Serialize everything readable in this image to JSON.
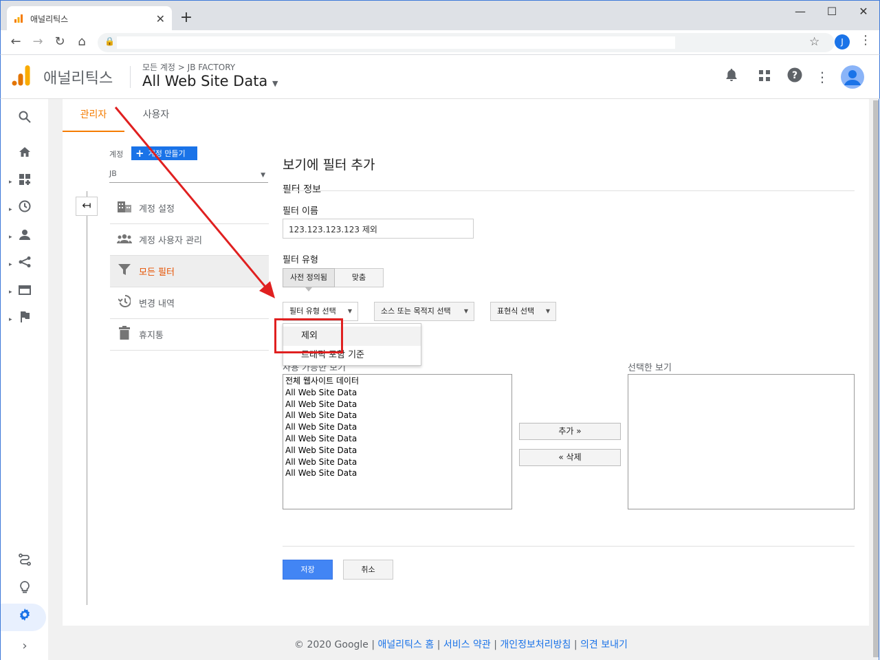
{
  "browser": {
    "tab_title": "애널리틱스",
    "new_tab": "+",
    "profile_initial": "J"
  },
  "header": {
    "app_name": "애널리틱스",
    "breadcrumb": "모든 계정 > JB FACTORY",
    "property_name": "All Web Site Data"
  },
  "tabs": {
    "admin": "관리자",
    "user": "사용자"
  },
  "account": {
    "label": "계정",
    "create_button": "계정 만들기",
    "selected": "JB"
  },
  "menu": [
    {
      "label": "계정 설정",
      "icon": "building-icon"
    },
    {
      "label": "계정 사용자 관리",
      "icon": "people-icon"
    },
    {
      "label": "모든 필터",
      "icon": "filter-icon"
    },
    {
      "label": "변경 내역",
      "icon": "history-icon"
    },
    {
      "label": "휴지통",
      "icon": "trash-icon"
    }
  ],
  "form": {
    "title": "보기에 필터 추가",
    "section": "필터 정보",
    "name_label": "필터 이름",
    "name_value": "123.123.123.123 제외",
    "type_label": "필터 유형",
    "seg_predefined": "사전 정의됨",
    "seg_custom": "맞춤",
    "dd_type": "필터 유형 선택",
    "dd_source": "소스 또는 목적지 선택",
    "dd_expr": "표현식 선택",
    "options": [
      "제외",
      "트래픽 포함 기준"
    ],
    "available_label": "사용 가능한 보기",
    "selected_label": "선택한 보기",
    "available_views": [
      "전체 웹사이트 데이터",
      "All Web Site Data",
      "All Web Site Data",
      "All Web Site Data",
      "All Web Site Data",
      "All Web Site Data",
      "All Web Site Data",
      "All Web Site Data",
      "All Web Site Data"
    ],
    "add_button": "추가 »",
    "remove_button": "« 삭제",
    "save_button": "저장",
    "cancel_button": "취소"
  },
  "footer": {
    "copyright": "© 2020 Google",
    "links": [
      "애널리틱스 홈",
      "서비스 약관",
      "개인정보처리방침",
      "의견 보내기"
    ]
  },
  "colors": {
    "accent_orange": "#f57c00",
    "primary_blue": "#1a73e8",
    "highlight_red": "#e02020"
  }
}
